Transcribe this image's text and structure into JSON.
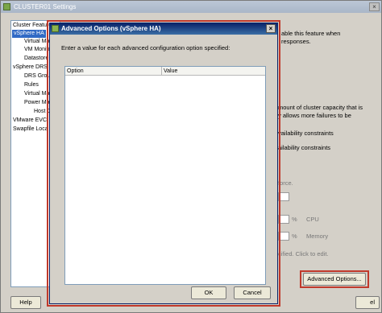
{
  "window": {
    "title": "CLUSTER01 Settings",
    "close_glyph": "×"
  },
  "tree": {
    "items": [
      {
        "label": "Cluster Features",
        "selected": false
      },
      {
        "label": "vSphere HA",
        "selected": true
      },
      {
        "label": "Virtual Ma",
        "selected": false
      },
      {
        "label": "VM Monito",
        "selected": false
      },
      {
        "label": "Datastore",
        "selected": false
      },
      {
        "label": "vSphere DRS",
        "selected": false
      },
      {
        "label": "DRS Grou",
        "selected": false
      },
      {
        "label": "Rules",
        "selected": false
      },
      {
        "label": "Virtual Ma",
        "selected": false
      },
      {
        "label": "Power Ma",
        "selected": false
      },
      {
        "label": "Host C",
        "selected": false
      },
      {
        "label": "VMware EVC",
        "selected": false
      },
      {
        "label": "Swapfile Loca",
        "selected": false
      }
    ]
  },
  "right_panel": {
    "line1": "able this feature when",
    "line2": "responses.",
    "line3": "mount of cluster capacity that is",
    "line4": "y allows more failures to be",
    "line5": "vailability constraints",
    "line6": "ailability constraints",
    "line7": "force.",
    "cpu_unit": "%",
    "cpu_label": "CPU",
    "mem_unit": "%",
    "mem_label": "Memory",
    "line8": "cified. Click to edit."
  },
  "buttons": {
    "advanced_options": "Advanced Options...",
    "help": "Help",
    "outer_cancel": "el"
  },
  "dialog": {
    "title": "Advanced Options (vSphere HA)",
    "close_glyph": "×",
    "prompt": "Enter a value for each advanced configuration option specified:",
    "columns": [
      "Option",
      "Value"
    ],
    "rows": [],
    "ok_label": "OK",
    "cancel_label": "Cancel"
  },
  "colors": {
    "highlight_frame": "#c0392b",
    "selection": "#316ac5",
    "dialog_title": "#0a246a"
  }
}
